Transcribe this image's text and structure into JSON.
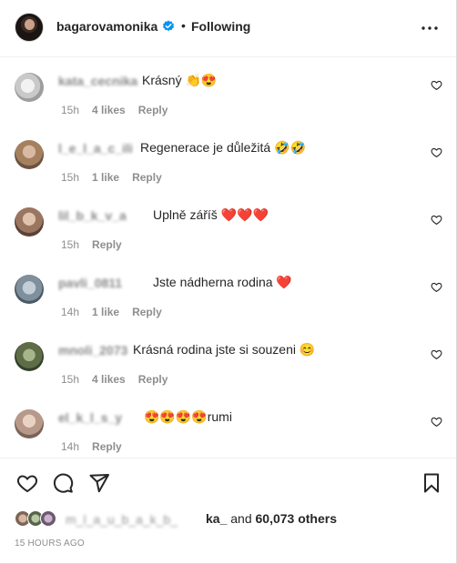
{
  "header": {
    "username": "bagarovamonika",
    "separator": "•",
    "follow_status": "Following"
  },
  "comments": [
    {
      "handle": "kata_cecnika",
      "text": "Krásný 👏😍",
      "time": "15h",
      "likes": "4 likes",
      "reply": "Reply"
    },
    {
      "handle": "l_e_l_a_c_ili",
      "text": "Regenerace je důležitá 🤣🤣",
      "time": "15h",
      "likes": "1 like",
      "reply": "Reply"
    },
    {
      "handle": "lil_b_k_v_a",
      "text": "Uplně záříš ❤️❤️❤️",
      "time": "15h",
      "likes": "",
      "reply": "Reply"
    },
    {
      "handle": "pavli_0811",
      "text": "Jste nádherna rodina ❤️",
      "time": "14h",
      "likes": "1 like",
      "reply": "Reply"
    },
    {
      "handle": "mnoli_2073",
      "text": "Krásná rodina jste si souzeni 😊",
      "time": "15h",
      "likes": "4 likes",
      "reply": "Reply"
    },
    {
      "handle": "el_k_l_s_y",
      "text": "😍😍😍😍rumi",
      "time": "14h",
      "likes": "",
      "reply": "Reply"
    }
  ],
  "liked_by": {
    "blurred": "m_l_a_u_b_a_k_b_",
    "name": "ka_",
    "and": " and ",
    "count": "60,073 others"
  },
  "post_time": "15 HOURS AGO",
  "colors": {
    "text": "#262626",
    "muted": "#8e8e8e",
    "verified": "#0095f6",
    "border": "#dbdbdb"
  }
}
